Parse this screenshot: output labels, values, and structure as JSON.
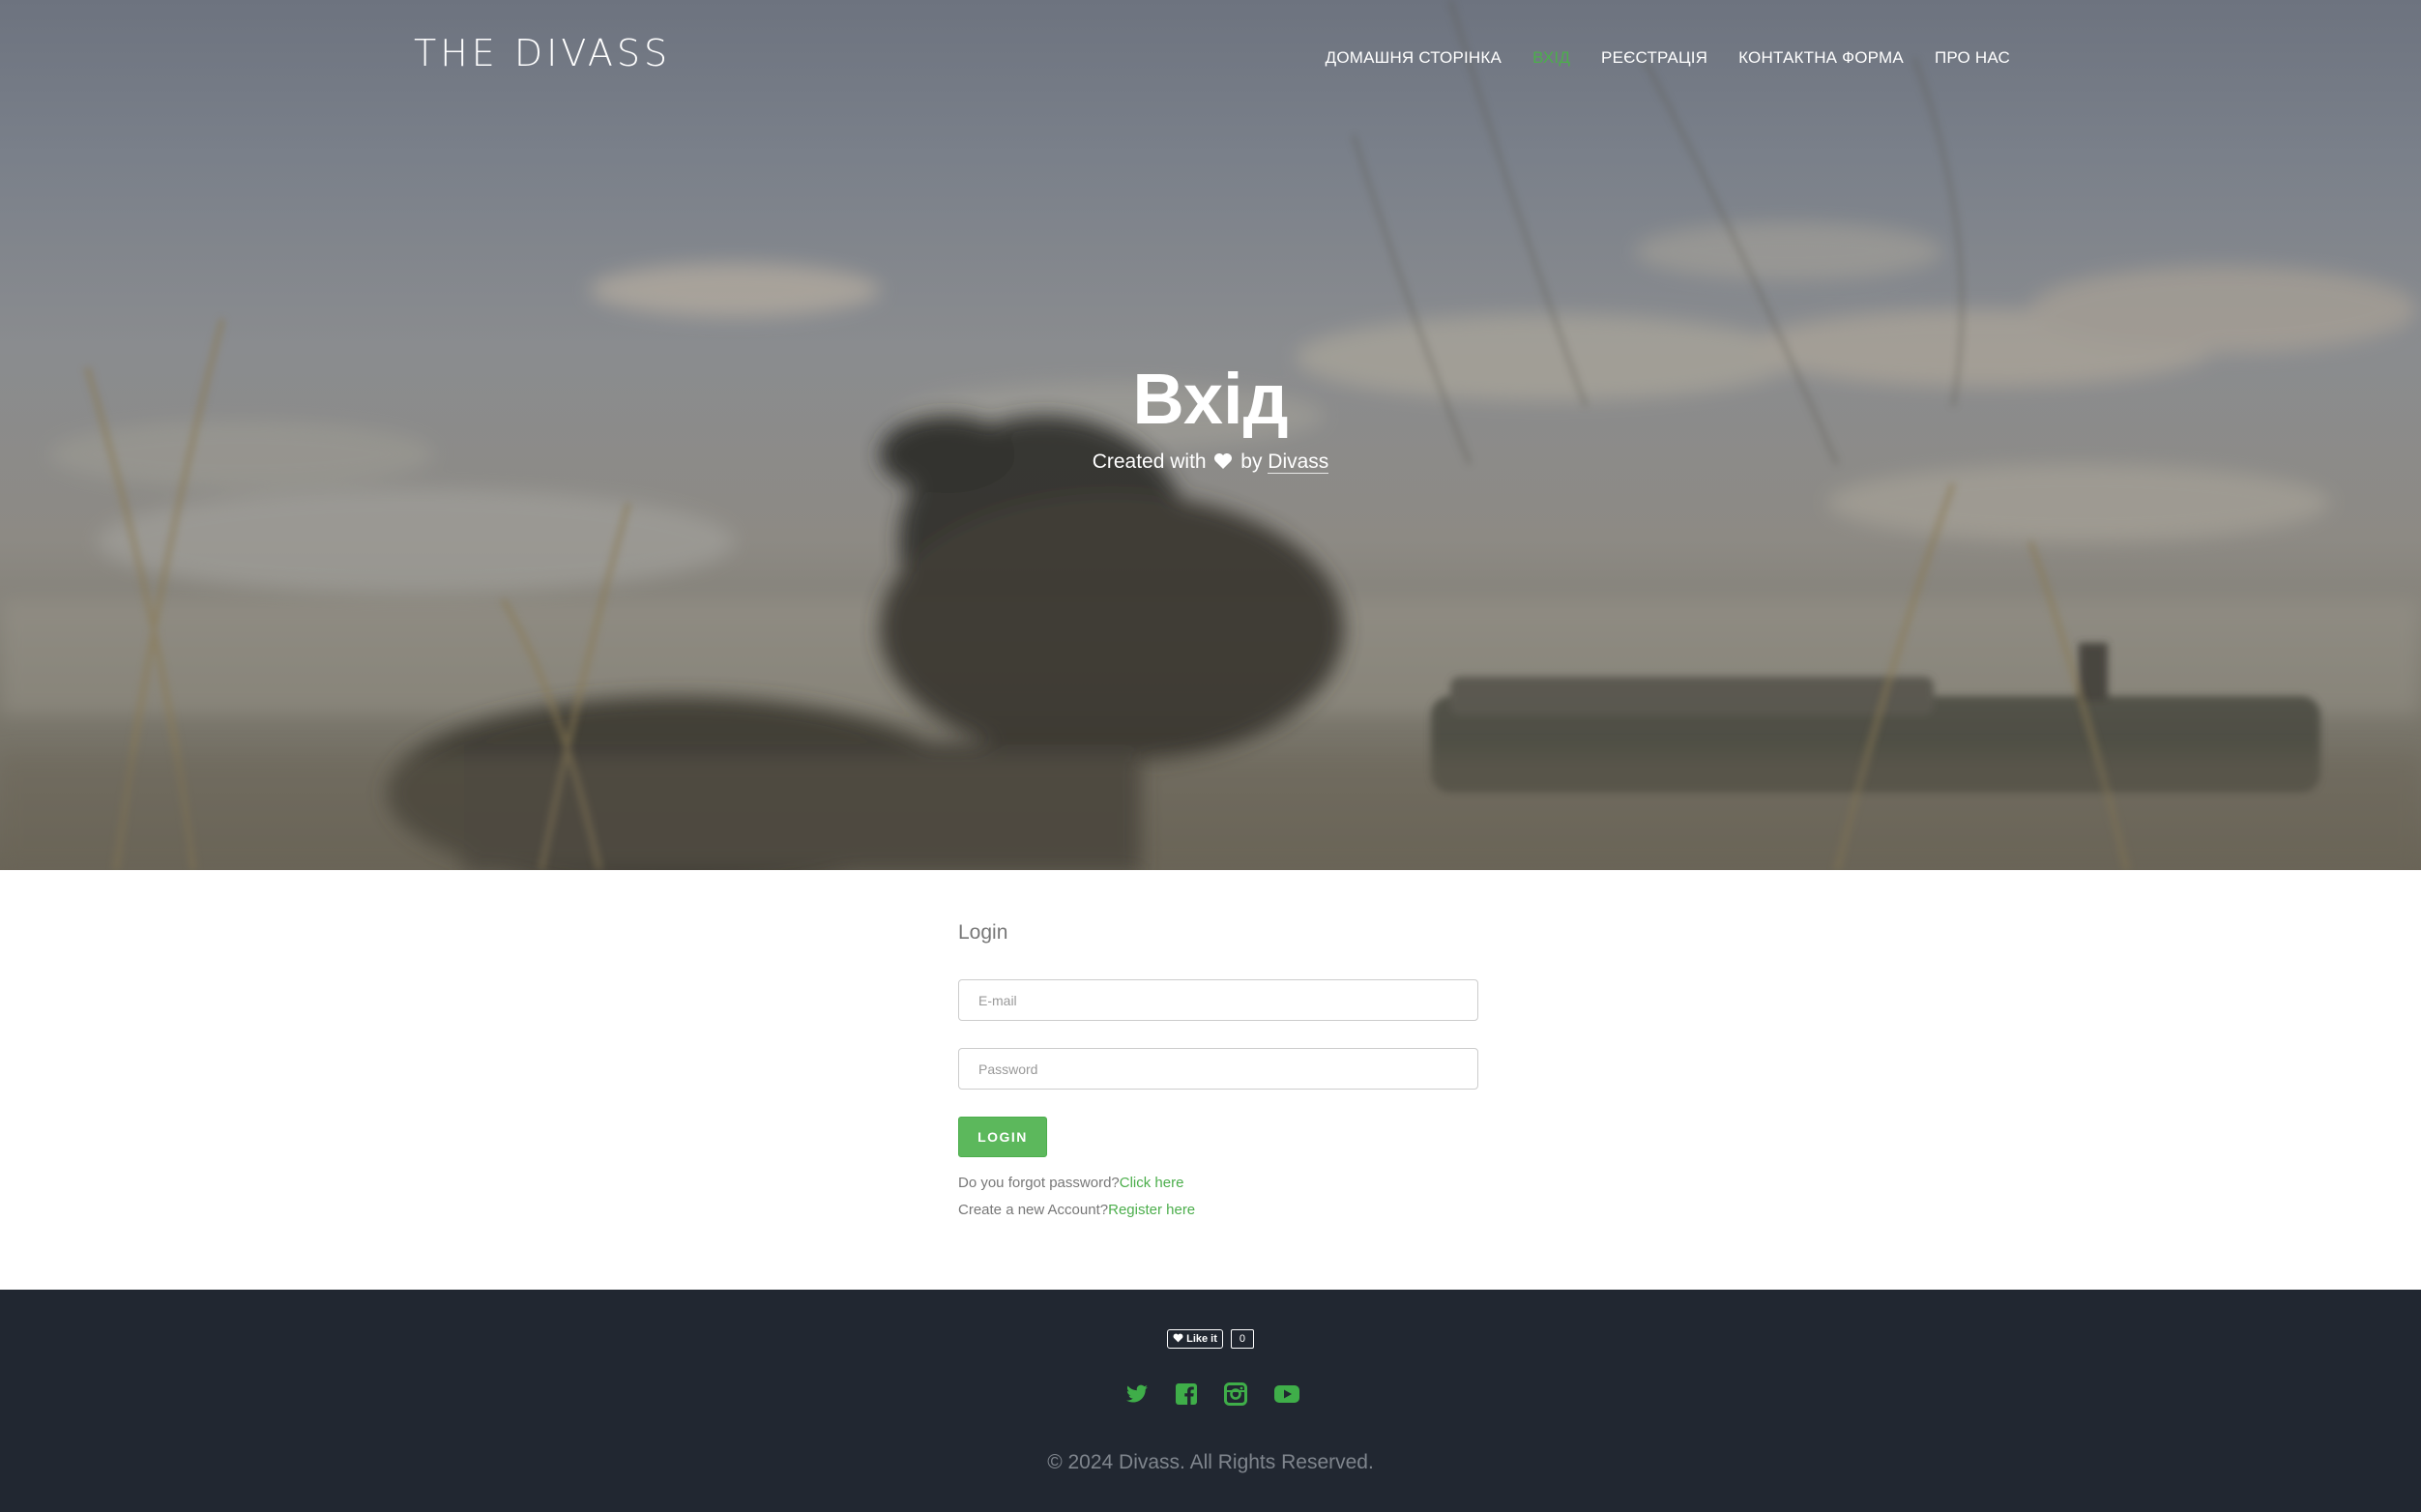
{
  "header": {
    "logo": "THE DIVASS",
    "nav": [
      {
        "label": "ДОМАШНЯ СТОРІНКА",
        "active": false
      },
      {
        "label": "ВХІД",
        "active": true
      },
      {
        "label": "РЕЄСТРАЦІЯ",
        "active": false
      },
      {
        "label": "КОНТАКТНА ФОРМА",
        "active": false
      },
      {
        "label": "ПРО НАС",
        "active": false
      }
    ]
  },
  "hero": {
    "title": "Вхід",
    "sub_prefix": "Created with",
    "sub_by": "by",
    "sub_link": "Divass",
    "heart_icon": "heart-icon"
  },
  "login": {
    "heading": "Login",
    "email_placeholder": "E-mail",
    "password_placeholder": "Password",
    "button": "LOGIN",
    "forgot_text": "Do you forgot password?",
    "forgot_link": "Click here",
    "register_text": "Create a new Account?",
    "register_link": "Register here"
  },
  "footer": {
    "like_label": "Like it",
    "like_count": "0",
    "socials": [
      "twitter-icon",
      "facebook-icon",
      "instagram-icon",
      "youtube-icon"
    ],
    "copyright": "© 2024 Divass. All Rights Reserved."
  },
  "colors": {
    "accent": "#5cb85c",
    "footer_bg": "#212731",
    "nav_active": "#4cae4c"
  }
}
